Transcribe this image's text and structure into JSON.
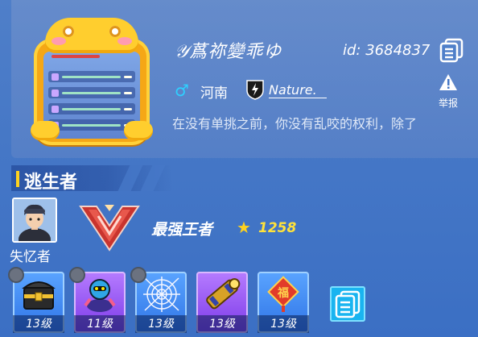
{
  "profile": {
    "username": "𝒴蔿祢變乖ゆ",
    "id_text": "id: 3684837",
    "gender_symbol": "♂",
    "region": "河南",
    "clan_name": "Nature.",
    "report_label": "举报",
    "signature": "在没有单挑之前，你没有乱咬的权利，除了"
  },
  "section": {
    "title": "逃生者"
  },
  "character": {
    "name": "失忆者"
  },
  "rank": {
    "name": "最强王者",
    "score": "1258"
  },
  "items": [
    {
      "level": "13级",
      "locked": true,
      "rarity": "blue",
      "icon": "treasure-chest-icon"
    },
    {
      "level": "11级",
      "locked": true,
      "rarity": "purple",
      "icon": "robot-pet-icon"
    },
    {
      "level": "13级",
      "locked": true,
      "rarity": "blue",
      "icon": "spider-web-icon"
    },
    {
      "level": "13级",
      "locked": false,
      "rarity": "purple",
      "icon": "gold-cannon-icon"
    },
    {
      "level": "13级",
      "locked": false,
      "rarity": "blue",
      "icon": "fu-charm-icon"
    }
  ],
  "colors": {
    "background": "#4577c6",
    "accent_yellow": "#ffd21e",
    "gender_blue": "#2ed0ff",
    "score_yellow": "#ffe23a"
  }
}
